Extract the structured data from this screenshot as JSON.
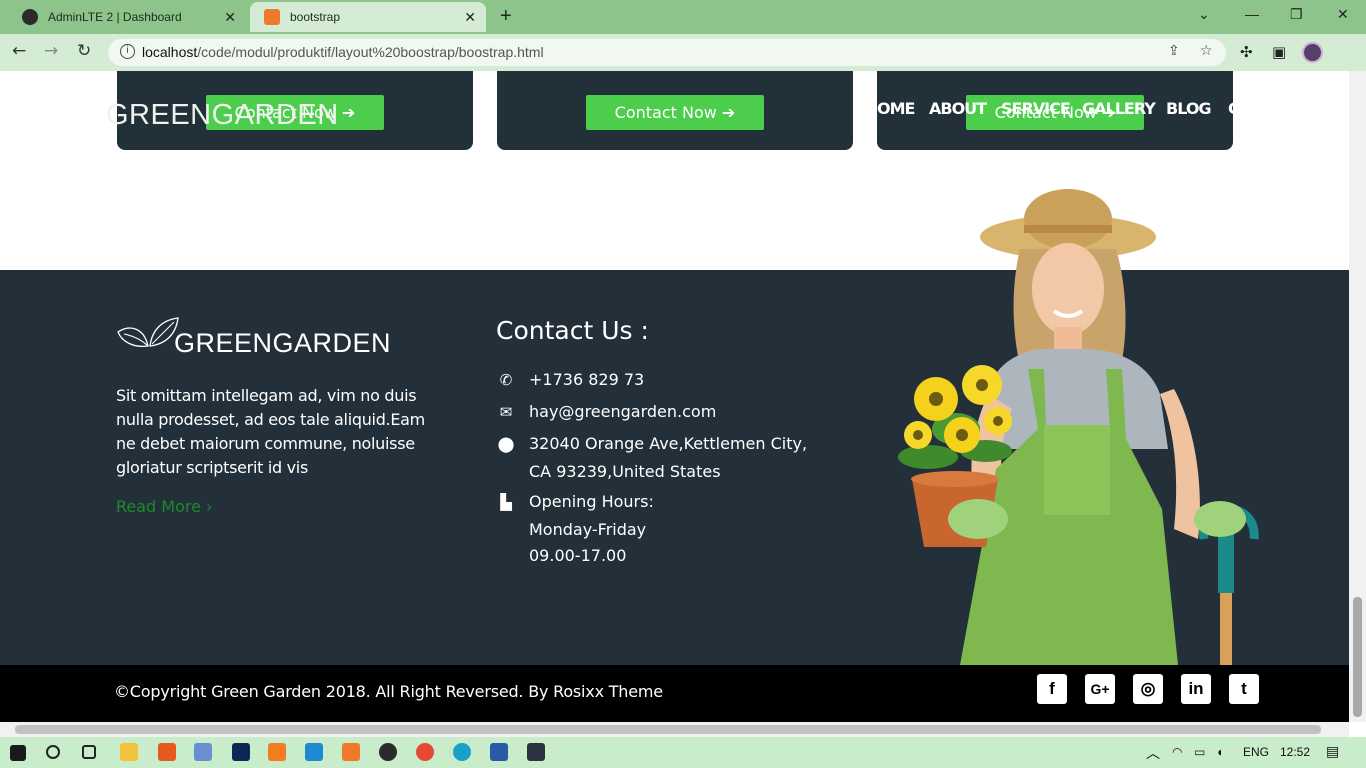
{
  "browser": {
    "tabs": [
      {
        "title": "AdminLTE 2 | Dashboard"
      },
      {
        "title": "bootstrap"
      }
    ],
    "url_host": "localhost",
    "url_path": "/code/modul/produktif/layout%20boostrap/boostrap.html"
  },
  "page": {
    "cards": [
      {
        "button": "Contact Now ➔"
      },
      {
        "button": "Contact Now ➔"
      },
      {
        "button": "Contact Now ➔"
      }
    ],
    "overlay": {
      "logo": "GREENGARDEN",
      "nav": [
        "OME",
        "ABOUT",
        "SERVICE",
        "GALLERY",
        "BLOG",
        "C"
      ]
    },
    "footer": {
      "logo": "GREENGARDEN",
      "about_text": "Sit omittam intellegam ad, vim no duis nulla prodesset, ad eos tale aliquid.Eam ne debet maiorum commune, noluisse gloriatur scriptserit id vis",
      "read_more": "Read More ›",
      "contact_title": "Contact Us :",
      "phone": "+1736 829 73",
      "email": "hay@greengarden.com",
      "address_line1": "32040 Orange Ave,Kettlemen City,",
      "address_line2": "CA 93239,United States",
      "hours_label": "Opening Hours:",
      "hours_days": "Monday-Friday",
      "hours_time": "09.00-17.00"
    },
    "copyright": "©Copyright Green Garden 2018. All Right Reversed. By Rosixx Theme",
    "social": [
      {
        "icon": "facebook-icon",
        "glyph": "f"
      },
      {
        "icon": "google-plus-icon",
        "glyph": "G+"
      },
      {
        "icon": "instagram-icon",
        "glyph": "◎"
      },
      {
        "icon": "linkedin-icon",
        "glyph": "in"
      },
      {
        "icon": "twitter-icon",
        "glyph": "t"
      }
    ]
  },
  "taskbar": {
    "language": "ENG",
    "time": "12:52"
  },
  "colors": {
    "tab_bar": "#8cc48c",
    "dark_bg": "#23303a",
    "button_green": "#4ccd4c",
    "read_more": "#1d8a2a"
  }
}
